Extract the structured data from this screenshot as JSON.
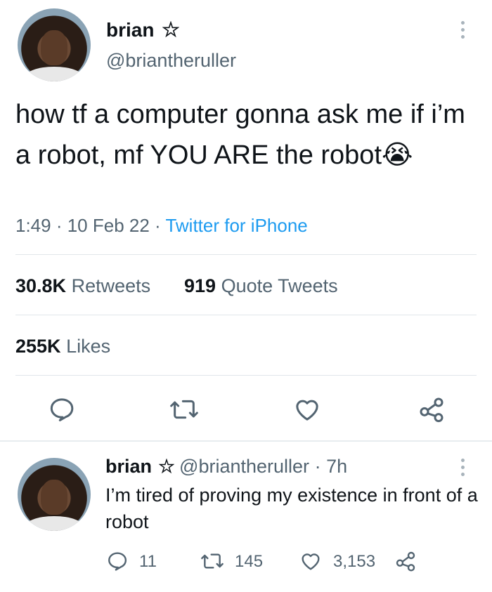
{
  "main_tweet": {
    "author_name": "brian",
    "author_handle": "@briantheruller",
    "text": "how tf a computer gonna ask me if i’m a robot, mf YOU ARE the robot",
    "emoji": "😭",
    "time": "1:49",
    "date": "10 Feb 22",
    "source": "Twitter for iPhone",
    "retweets_count": "30.8K",
    "retweets_label": "Retweets",
    "quotes_count": "919",
    "quotes_label": "Quote Tweets",
    "likes_count": "255K",
    "likes_label": "Likes"
  },
  "reply_tweet": {
    "author_name": "brian",
    "author_handle": "@briantheruller",
    "time_ago": "7h",
    "text": "I’m tired of proving my existence in front of a robot",
    "reply_count": "11",
    "retweet_count": "145",
    "like_count": "3,153"
  },
  "icons": [
    "pentagram-icon",
    "more-icon",
    "reply-icon",
    "retweet-icon",
    "like-icon",
    "share-icon"
  ],
  "colors": {
    "link": "#1d9bf0",
    "secondary": "#536471",
    "primary": "#0f1419"
  }
}
